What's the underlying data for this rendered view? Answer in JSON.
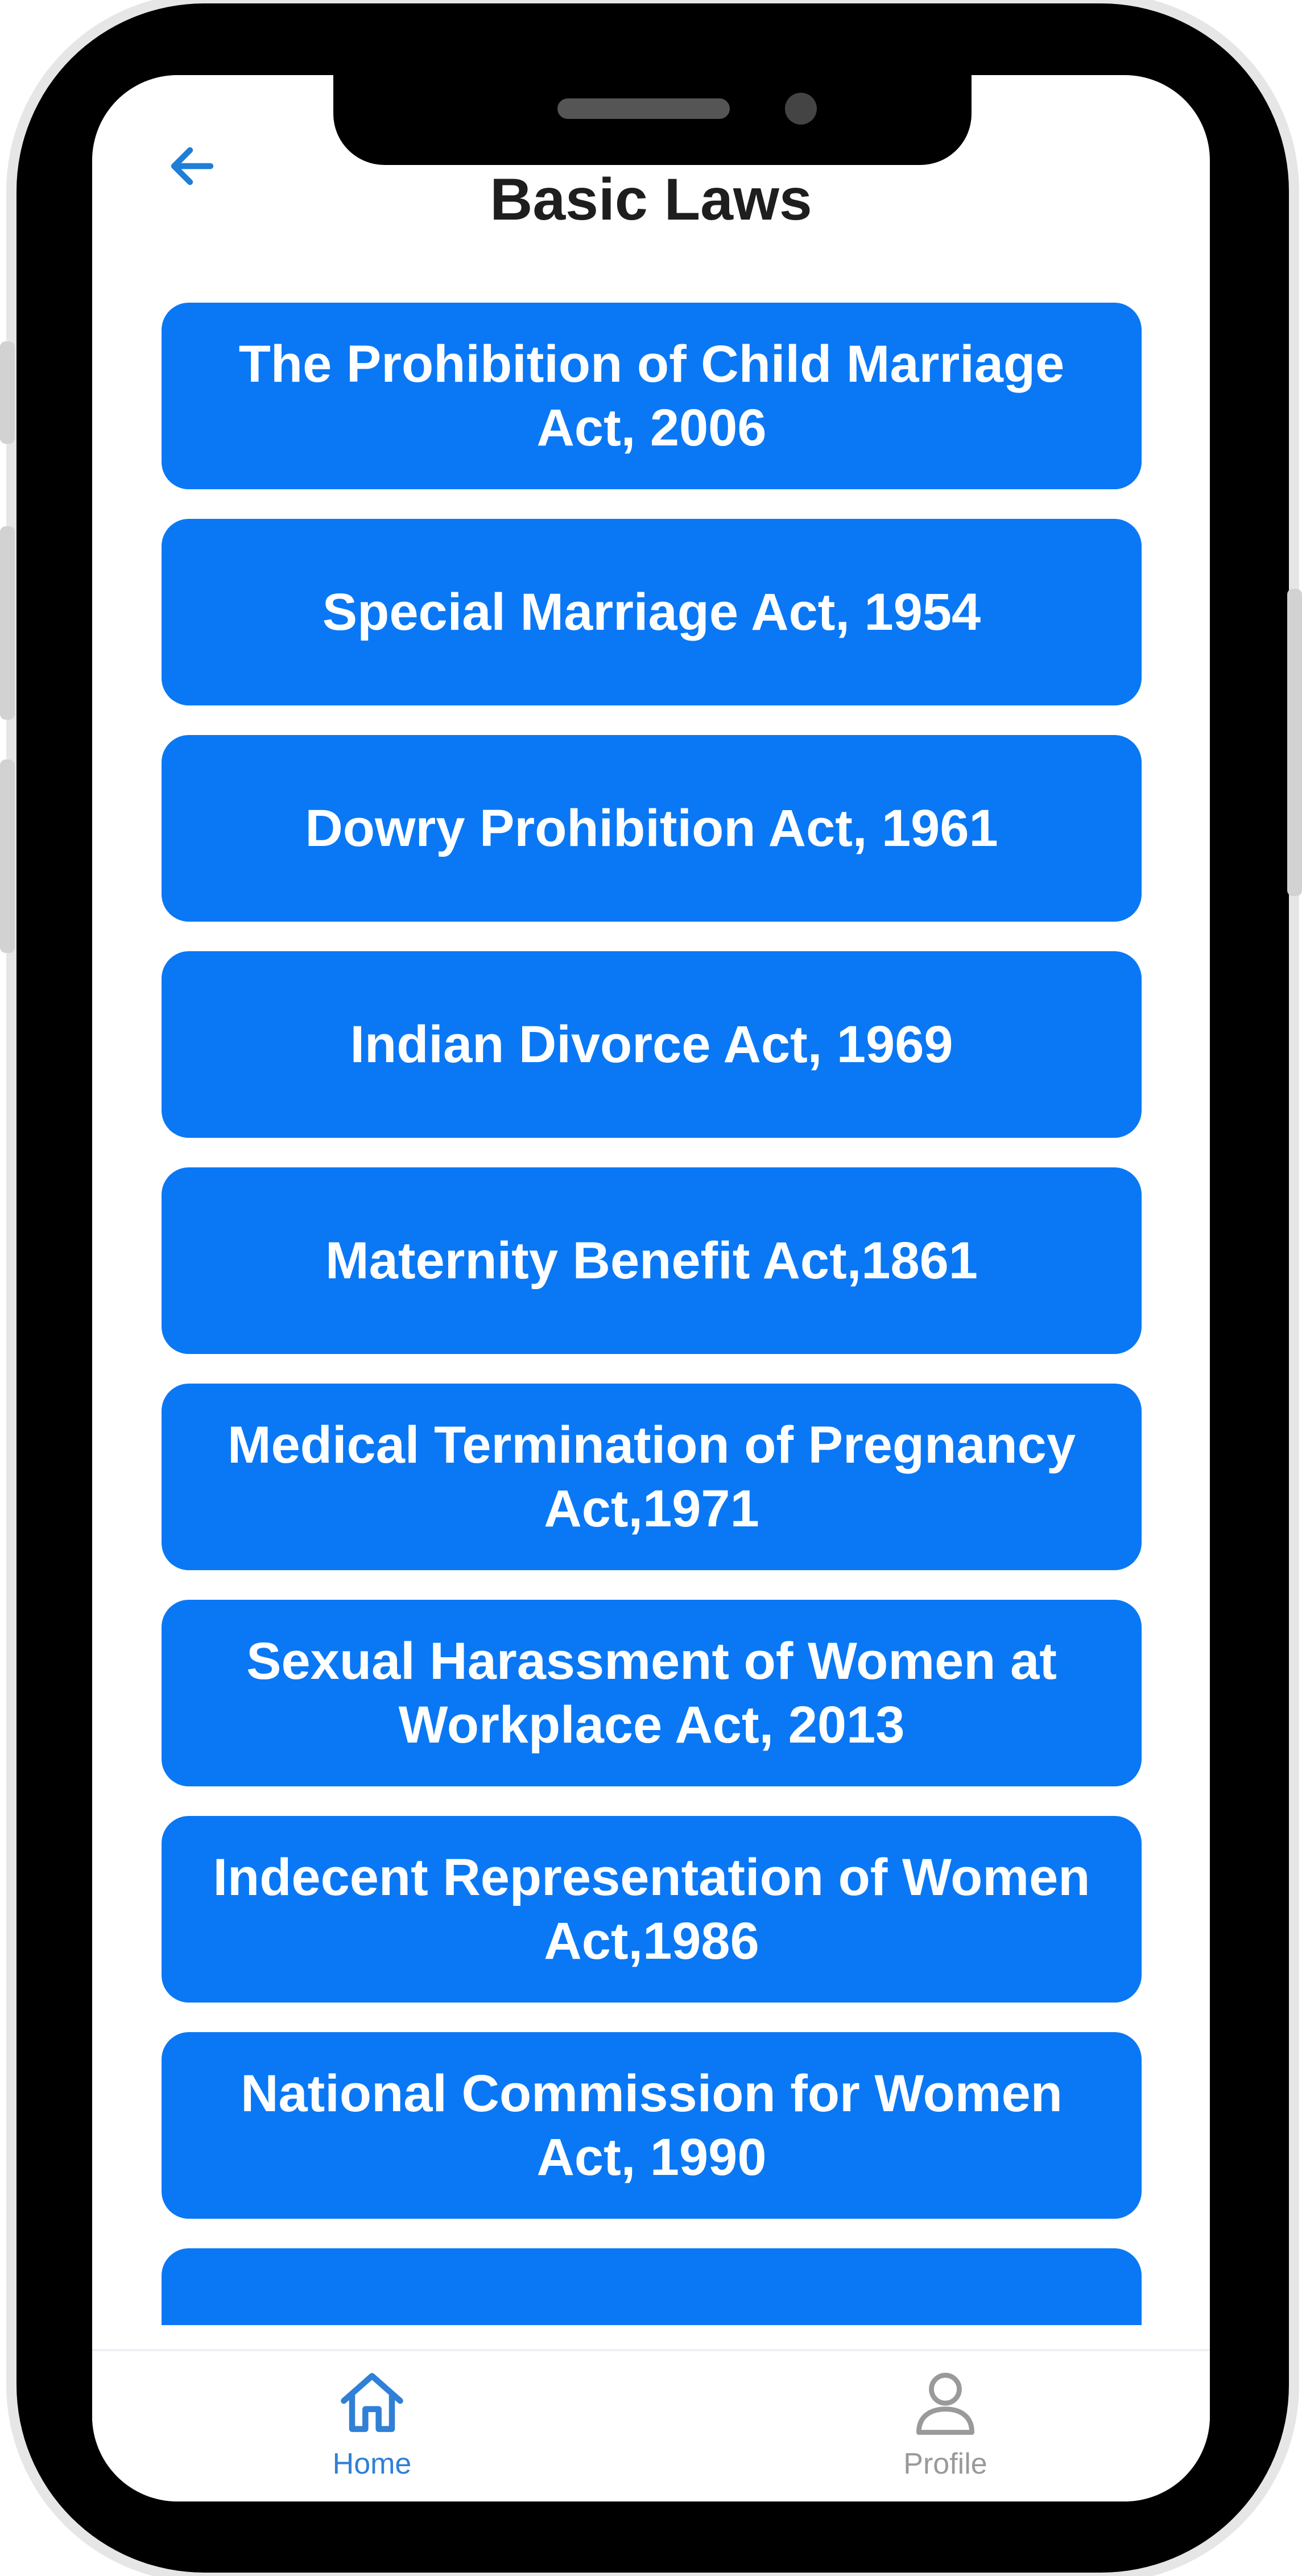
{
  "header": {
    "title": "Basic Laws"
  },
  "laws": [
    "The Prohibition of Child Marriage Act, 2006",
    "Special Marriage Act, 1954",
    "Dowry Prohibition Act, 1961",
    "Indian Divorce Act, 1969",
    "Maternity Benefit Act,1861",
    "Medical Termination of Pregnancy Act,1971",
    "Sexual Harassment of Women at Workplace Act, 2013",
    "Indecent Representation of Women Act,1986",
    "National Commission for Women Act, 1990",
    ""
  ],
  "bottom_nav": {
    "home_label": "Home",
    "profile_label": "Profile",
    "active": "Home"
  },
  "colors": {
    "accent": "#0a78f5",
    "nav_active": "#2f80d6",
    "nav_inactive": "#9a9a9a"
  },
  "icons": {
    "back": "arrow-left-icon",
    "home": "home-icon",
    "profile": "user-icon"
  }
}
